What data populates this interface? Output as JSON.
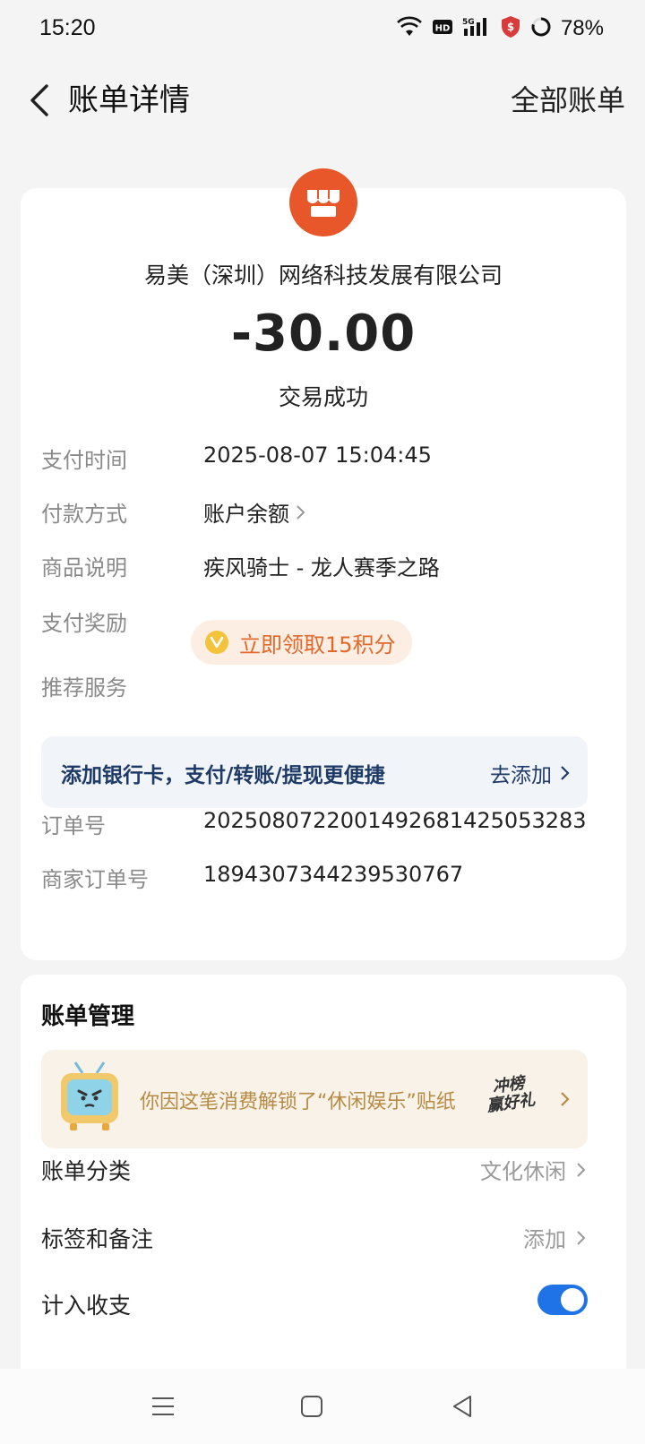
{
  "status_bar": {
    "time": "15:20",
    "battery": "78%",
    "icons": [
      "wifi-icon",
      "hd-icon",
      "signal-5g-icon",
      "security-shield-icon",
      "battery-ring-icon"
    ]
  },
  "nav": {
    "title": "账单详情",
    "right_link": "全部账单"
  },
  "merchant": {
    "name": "易美（深圳）网络科技发展有限公司",
    "amount": "-30.00",
    "status": "交易成功",
    "logo_icon": "store-icon",
    "logo_color": "#e8572a"
  },
  "details": [
    {
      "label": "支付时间",
      "value": "2025-08-07 15:04:45"
    },
    {
      "label": "付款方式",
      "value": "账户余额"
    },
    {
      "label": "商品说明",
      "value": "疾风骑士 - 龙人赛季之路"
    },
    {
      "label": "支付奖励",
      "value": "立即领取15积分"
    },
    {
      "label": "推荐服务",
      "value": ""
    },
    {
      "label": "订单号",
      "value": "2025080722001492681425053283"
    },
    {
      "label": "商家订单号",
      "value": "1894307344239530767"
    }
  ],
  "bank_banner": {
    "text": "添加银行卡，支付/转账/提现更便捷",
    "action": "去添加"
  },
  "management": {
    "title": "账单管理",
    "sticker_text": "你因这笔消费解锁了“休闲娱乐”贴纸",
    "sticker_badge_line1": "冲榜",
    "sticker_badge_line2": "赢好礼",
    "rows": [
      {
        "label": "账单分类",
        "value": "文化休闲"
      },
      {
        "label": "标签和备注",
        "value": "添加"
      },
      {
        "label": "计入收支",
        "value": ""
      }
    ],
    "include_in_stats": true
  },
  "colors": {
    "accent_blue": "#1f73e6",
    "reward_orange": "#e3682a",
    "banner_text": "#1e3a66"
  }
}
